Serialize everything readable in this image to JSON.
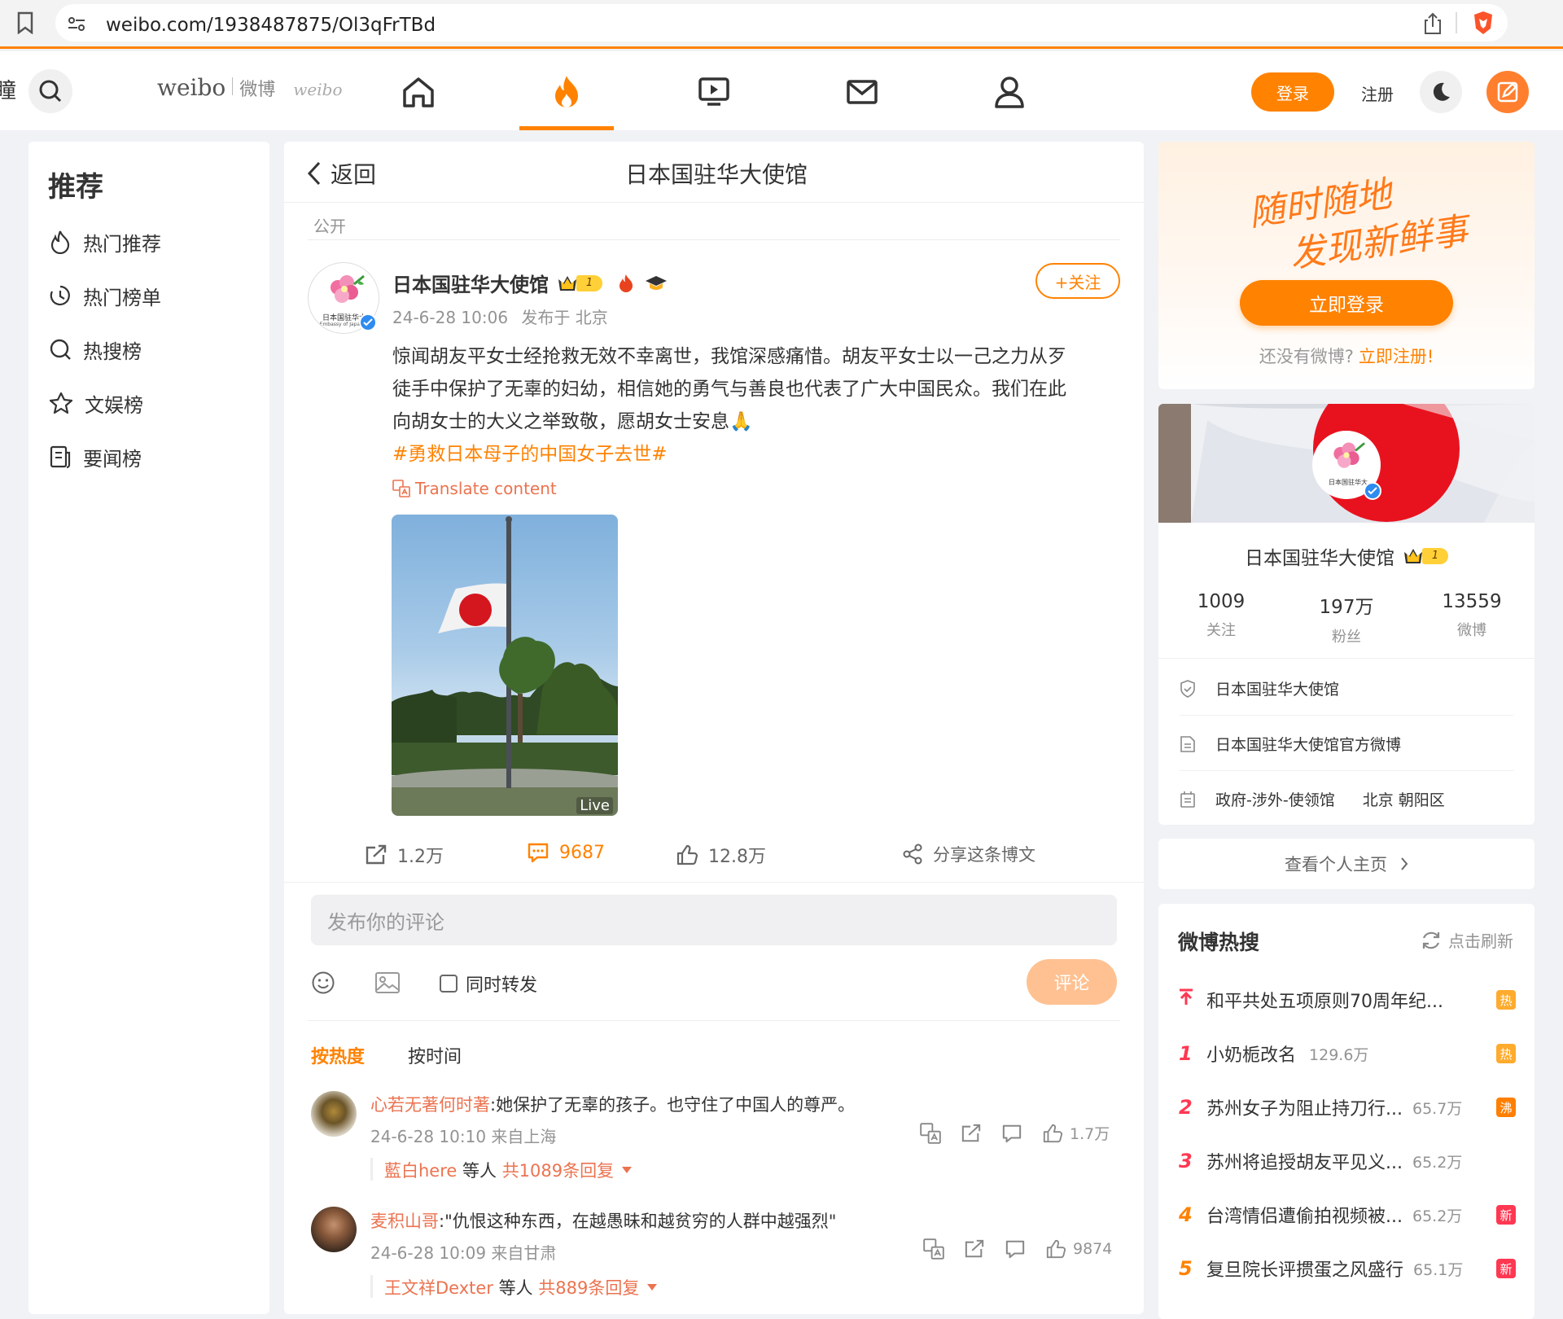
{
  "browser": {
    "url": "weibo.com/1938487875/Ol3qFrTBd"
  },
  "nav": {
    "logo_en": "weibo",
    "logo_cn": "微博",
    "logo_script": "weibo",
    "edge_char": "瞳",
    "login": "登录",
    "register": "注册"
  },
  "sidebar": {
    "title": "推荐",
    "items": [
      {
        "label": "热门推荐",
        "icon": "flame-icon"
      },
      {
        "label": "热门榜单",
        "icon": "clock-icon"
      },
      {
        "label": "热搜榜",
        "icon": "search-icon"
      },
      {
        "label": "文娱榜",
        "icon": "star-icon"
      },
      {
        "label": "要闻榜",
        "icon": "news-icon"
      }
    ]
  },
  "post": {
    "back": "返回",
    "header_title": "日本国驻华大使馆",
    "visibility": "公开",
    "author": "日本国驻华大使馆",
    "level": "1",
    "follow": "+关注",
    "time": "24-6-28 10:06",
    "location": "发布于 北京",
    "text_line1": "惊闻胡友平女士经抢救无效不幸离世，我馆深感痛惜。胡友平女士以一己之力从歹",
    "text_line2": "徒手中保护了无辜的妇幼，相信她的勇气与善良也代表了广大中国民众。我们在此",
    "text_line3": "向胡女士的大义之举致敬，愿胡女士安息🙏",
    "hashtag": "#勇救日本母子的中国女子去世#",
    "translate": "Translate content",
    "live": "Live",
    "reposts": "1.2万",
    "comments": "9687",
    "likes": "12.8万",
    "share": "分享这条博文",
    "avatar_text": "日本国驻华大",
    "avatar_text2": "Embassy of Japan in"
  },
  "composer": {
    "placeholder": "发布你的评论",
    "also_repost": "同时转发",
    "submit": "评论",
    "sort_hot": "按热度",
    "sort_time": "按时间"
  },
  "comments": [
    {
      "user": "心若无著何时著",
      "text": ":她保护了无辜的孩子。也守住了中国人的尊严。",
      "time": "24-6-28 10:10 来自上海",
      "likes": "1.7万",
      "reply_user": "藍白here",
      "reply_mid": " 等人 ",
      "reply_count": "共1089条回复"
    },
    {
      "user": "麦积山哥",
      "text": ":\"仇恨这种东西，在越愚昧和越贫穷的人群中越强烈\"",
      "time": "24-6-28 10:09 来自甘肃",
      "likes": "9874",
      "reply_user": "王文祥Dexter",
      "reply_mid": " 等人 ",
      "reply_count": "共889条回复"
    }
  ],
  "login_card": {
    "slogan1": "随时随地",
    "slogan2": "发现新鲜事",
    "login_now": "立即登录",
    "no_account": "还没有微博?",
    "register_now": "立即注册!"
  },
  "profile": {
    "name": "日本国驻华大使馆",
    "level": "1",
    "following": "1009",
    "following_label": "关注",
    "fans": "197万",
    "fans_label": "粉丝",
    "posts": "13559",
    "posts_label": "微博",
    "verified": "日本国驻华大使馆",
    "desc": "日本国驻华大使馆官方微博",
    "category": "政府-涉外-使领馆",
    "location": "北京 朝阳区",
    "view_home": "查看个人主页"
  },
  "hot_search": {
    "title": "微博热搜",
    "refresh": "点击刷新",
    "items": [
      {
        "rank": "",
        "text": "和平共处五项原则70周年纪...",
        "count": "",
        "tag": "热",
        "tag_color": "#ffab2d"
      },
      {
        "rank": "1",
        "text": "小奶栀改名",
        "count": "129.6万",
        "tag": "热",
        "tag_color": "#ffab2d"
      },
      {
        "rank": "2",
        "text": "苏州女子为阻止持刀行...",
        "count": "65.7万",
        "tag": "沸",
        "tag_color": "#ff7f00"
      },
      {
        "rank": "3",
        "text": "苏州将追授胡友平见义...",
        "count": "65.2万",
        "tag": "",
        "tag_color": ""
      },
      {
        "rank": "4",
        "text": "台湾情侣遭偷拍视频被...",
        "count": "65.2万",
        "tag": "新",
        "tag_color": "#ff3852"
      },
      {
        "rank": "5",
        "text": "复旦院长评掼蛋之风盛行",
        "count": "65.1万",
        "tag": "新",
        "tag_color": "#ff3852"
      }
    ]
  }
}
